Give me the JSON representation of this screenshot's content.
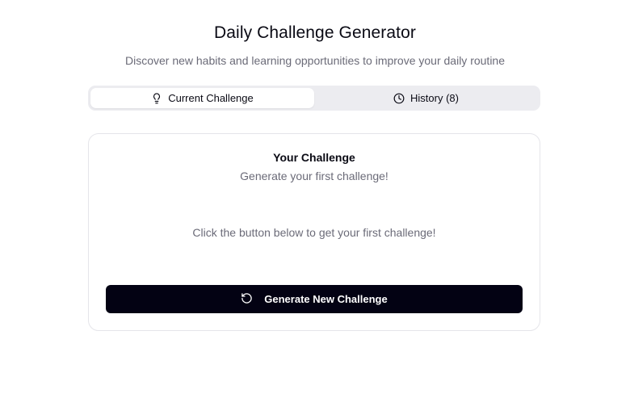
{
  "header": {
    "title": "Daily Challenge Generator",
    "subtitle": "Discover new habits and learning opportunities to improve your daily routine"
  },
  "tabs": [
    {
      "label": "Current Challenge",
      "icon": "lightbulb-icon",
      "active": true
    },
    {
      "label": "History (8)",
      "icon": "clock-icon",
      "active": false
    }
  ],
  "card": {
    "title": "Your Challenge",
    "description": "Generate your first challenge!",
    "empty_message": "Click the button below to get your first challenge!",
    "button_label": "Generate New Challenge",
    "button_icon": "refresh-icon"
  },
  "colors": {
    "primary": "#030213",
    "muted_text": "#6b6b78",
    "tab_bg": "#ececf0"
  }
}
